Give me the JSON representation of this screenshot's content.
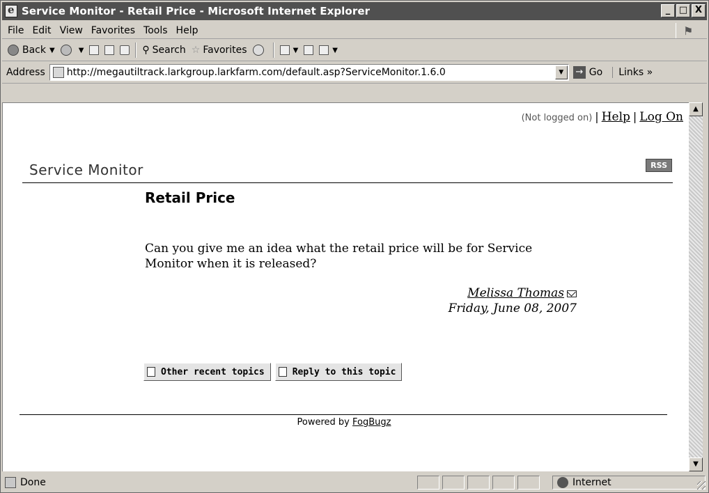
{
  "window": {
    "title": "Service Monitor - Retail Price - Microsoft Internet Explorer",
    "minimize": "_",
    "maximize": "□",
    "close": "X"
  },
  "menu": [
    "File",
    "Edit",
    "View",
    "Favorites",
    "Tools",
    "Help"
  ],
  "toolbar": {
    "back": "Back",
    "search": "Search",
    "favorites": "Favorites"
  },
  "address": {
    "label": "Address",
    "url": "http://megautiltrack.larkgroup.larkfarm.com/default.asp?ServiceMonitor.1.6.0",
    "go": "Go",
    "links": "Links »"
  },
  "page": {
    "login_status": "(Not logged on)",
    "help_link": "Help",
    "logon_link": "Log On",
    "site_title": "Service Monitor",
    "rss_badge": "RSS",
    "topic_title": "Retail Price",
    "body": "Can you give me an idea what the retail price will be for Service Monitor when it is released?",
    "author": "Melissa Thomas",
    "date": "Friday, June 08, 2007",
    "other_topics_button": "Other recent topics",
    "reply_button": "Reply to this topic",
    "powered_by": "Powered by",
    "powered_link": "FogBugz"
  },
  "status": {
    "text": "Done",
    "zone": "Internet"
  },
  "colors": {
    "titlebar_bg": "#505050",
    "content_bg": "#ffffff",
    "chrome_bg": "#d4d0c8"
  }
}
